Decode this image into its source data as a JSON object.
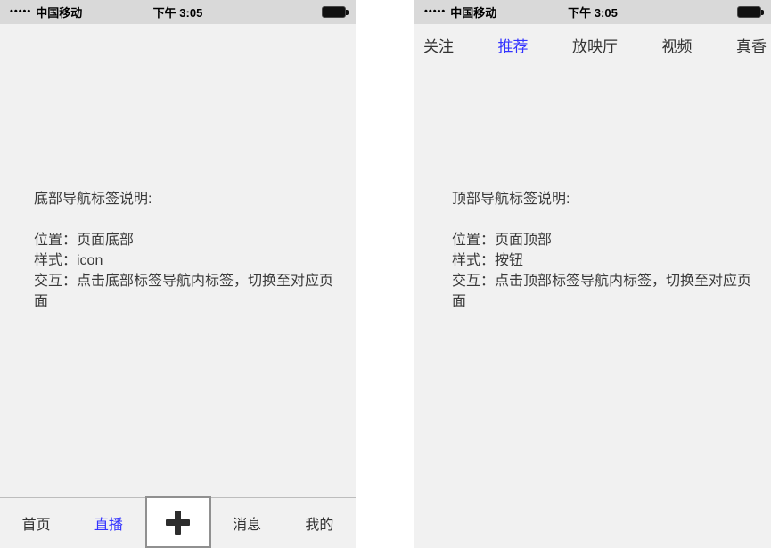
{
  "colors": {
    "accent_blue": "#3333ff",
    "phone_background": "#f1f1f1",
    "statusbar_background": "#d9d9d9",
    "text": "#3a3a3a"
  },
  "status_bar": {
    "signal_dots": "•••••",
    "carrier": "中国移动",
    "time": "下午 3:05"
  },
  "left_phone": {
    "spec": {
      "title": "底部导航标签说明:",
      "line_position": "位置：页面底部",
      "line_style": "样式：icon",
      "line_interaction": "交互：点击底部标签导航内标签，切换至对应页面"
    },
    "bottom_nav": {
      "items": [
        {
          "label": "首页",
          "selected": false
        },
        {
          "label": "直播",
          "selected": true
        },
        {
          "label": "+",
          "selected": false,
          "type": "plus-button"
        },
        {
          "label": "消息",
          "selected": false
        },
        {
          "label": "我的",
          "selected": false
        }
      ]
    }
  },
  "right_phone": {
    "top_nav": {
      "items": [
        {
          "label": "关注",
          "selected": false
        },
        {
          "label": "推荐",
          "selected": true
        },
        {
          "label": "放映厅",
          "selected": false
        },
        {
          "label": "视频",
          "selected": false
        },
        {
          "label": "真香",
          "selected": false
        }
      ]
    },
    "spec": {
      "title": "顶部导航标签说明:",
      "line_position": "位置：页面顶部",
      "line_style": "样式：按钮",
      "line_interaction": "交互：点击顶部标签导航内标签，切换至对应页面"
    }
  }
}
